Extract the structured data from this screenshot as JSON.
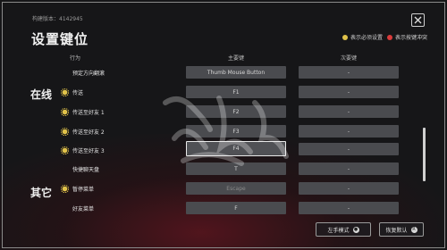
{
  "window": {
    "version": "构建版本：4142945",
    "title": "设置键位"
  },
  "legend": [
    {
      "label": "表示必须设置",
      "color": "#e0c24a",
      "icon": "gold-dot-icon"
    },
    {
      "label": "表示按键冲突",
      "color": "#d93b3b",
      "icon": "red-dot-icon"
    }
  ],
  "columns": {
    "action": "行为",
    "primary": "主要键",
    "secondary": "次要键"
  },
  "sections": {
    "online": "在线",
    "other": "其它"
  },
  "rows": [
    {
      "label": "预定方向翻滚",
      "required": false,
      "primary": "Thumb Mouse Button",
      "secondary": "-"
    },
    {
      "label": "传送",
      "required": true,
      "primary": "F1",
      "secondary": "-"
    },
    {
      "label": "传送至好友 1",
      "required": true,
      "primary": "F2",
      "secondary": "-"
    },
    {
      "label": "传送至好友 2",
      "required": true,
      "primary": "F3",
      "secondary": "-"
    },
    {
      "label": "传送至好友 3",
      "required": true,
      "primary": "F4",
      "secondary": "-",
      "selected": true
    },
    {
      "label": "快捷聊天盘",
      "required": false,
      "primary": "T",
      "secondary": "-"
    },
    {
      "label": "暂停菜单",
      "required": true,
      "primary": "Escape",
      "secondary": "-",
      "disabled": true
    },
    {
      "label": "好友菜单",
      "required": false,
      "primary": "F",
      "secondary": "-"
    }
  ],
  "buttons": {
    "left_hand_mode": "左手模式",
    "reset_default": "恢复默认",
    "reset_badge": "R"
  },
  "scrollbar": {
    "position_fraction": 0.48
  }
}
